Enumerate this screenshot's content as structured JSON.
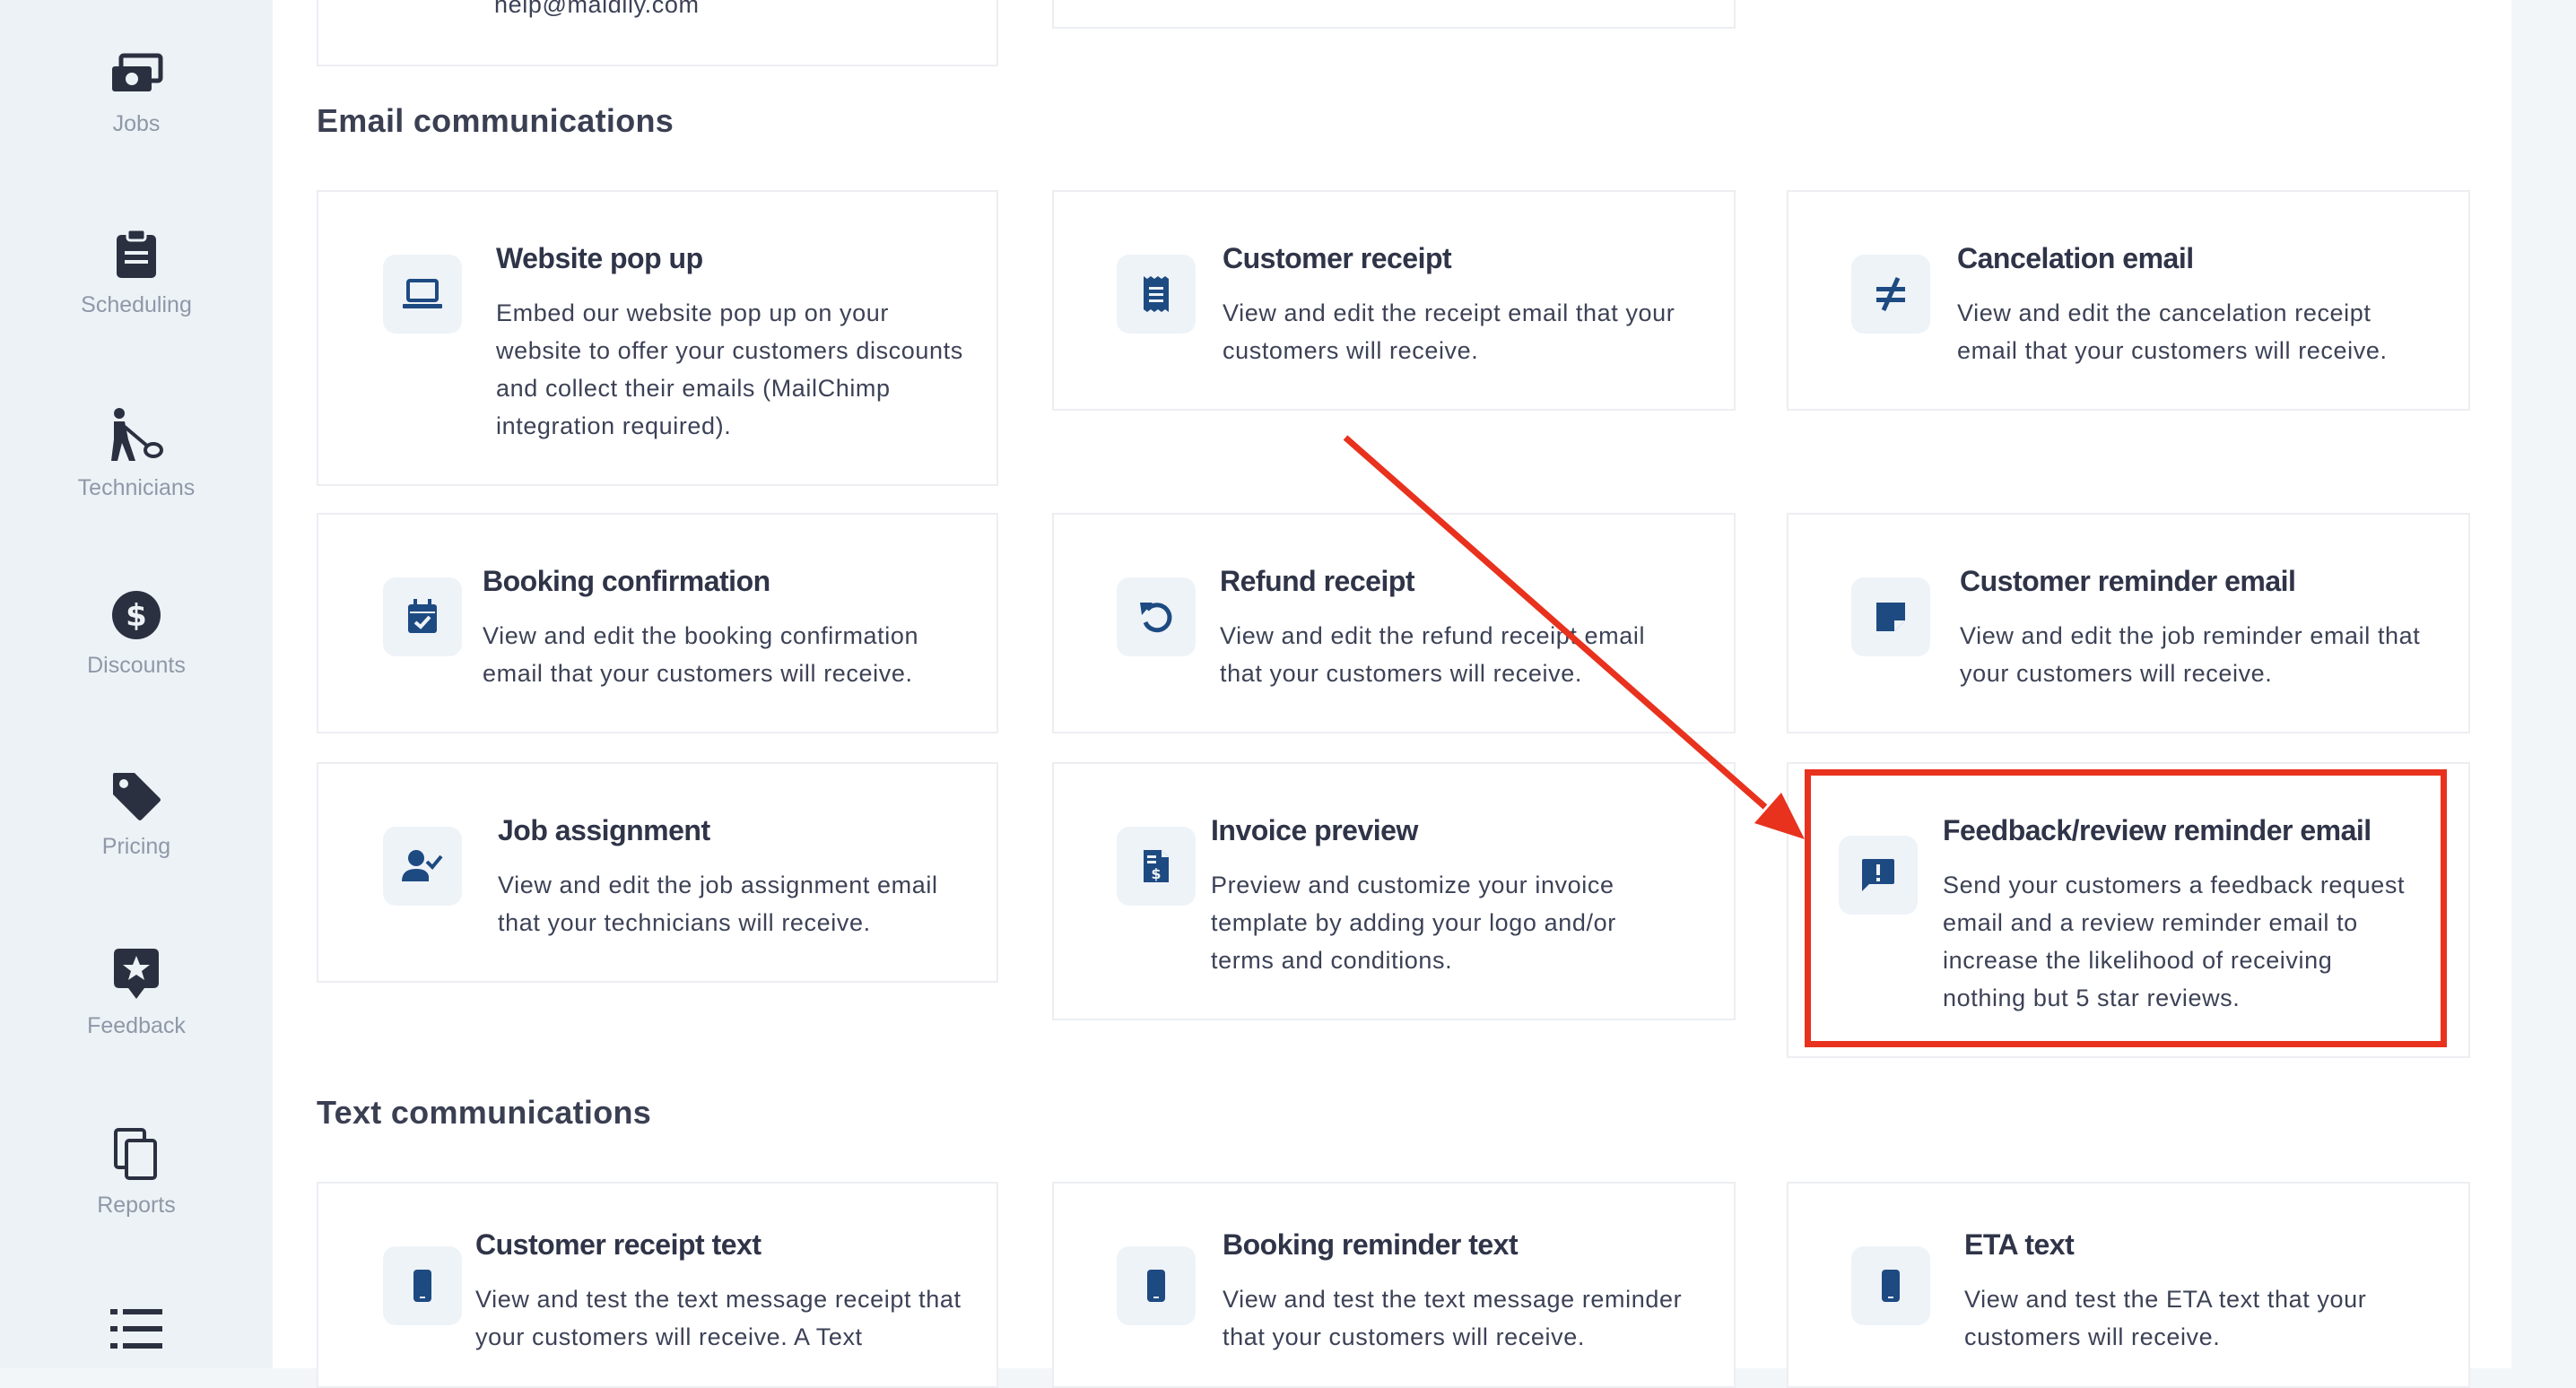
{
  "sidebar": {
    "items": [
      {
        "label": "Jobs",
        "icon": "jobs-icon"
      },
      {
        "label": "Scheduling",
        "icon": "clipboard-icon"
      },
      {
        "label": "Technicians",
        "icon": "technician-icon"
      },
      {
        "label": "Discounts",
        "icon": "dollar-icon"
      },
      {
        "label": "Pricing",
        "icon": "tag-icon"
      },
      {
        "label": "Feedback",
        "icon": "star-badge-icon"
      },
      {
        "label": "Reports",
        "icon": "copy-icon"
      },
      {
        "label": "",
        "icon": "list-icon"
      }
    ]
  },
  "top": {
    "email_snippet": "help@maidily.com"
  },
  "email_section": {
    "title": "Email communications",
    "cards": [
      {
        "title": "Website pop up",
        "icon": "laptop-icon",
        "desc": [
          "Embed our website pop up on your",
          "website to offer your customers discounts",
          "and collect their emails (MailChimp",
          "integration required)."
        ]
      },
      {
        "title": "Customer receipt",
        "icon": "receipt-icon",
        "desc": [
          "View and edit the receipt email that your",
          "customers will receive."
        ]
      },
      {
        "title": "Cancelation email",
        "icon": "not-equal-icon",
        "desc": [
          "View and edit the cancelation receipt",
          "email that your customers will receive."
        ]
      },
      {
        "title": "Booking confirmation",
        "icon": "calendar-check-icon",
        "desc": [
          "View and edit the booking confirmation",
          "email that your customers will receive."
        ]
      },
      {
        "title": "Refund receipt",
        "icon": "undo-icon",
        "desc": [
          "View and edit the refund receipt email",
          "that your customers will receive."
        ]
      },
      {
        "title": "Customer reminder email",
        "icon": "sticky-note-icon",
        "desc": [
          "View and edit the job reminder email that",
          "your customers will receive."
        ]
      },
      {
        "title": "Job assignment",
        "icon": "user-check-icon",
        "desc": [
          "View and edit the job assignment email",
          "that your technicians will receive."
        ]
      },
      {
        "title": "Invoice preview",
        "icon": "invoice-icon",
        "desc": [
          "Preview and customize your invoice",
          "template by adding your logo and/or",
          "terms and conditions."
        ]
      },
      {
        "title": "Feedback/review reminder email",
        "icon": "feedback-message-icon",
        "desc": [
          "Send your customers a feedback request",
          "email and a review reminder email to",
          "increase the likelihood of receiving",
          "nothing but 5 star reviews."
        ]
      }
    ]
  },
  "text_section": {
    "title": "Text communications",
    "cards": [
      {
        "title": "Customer receipt text",
        "icon": "phone-icon",
        "desc": [
          "View and test the text message receipt that",
          "your customers will receive. A Text"
        ]
      },
      {
        "title": "Booking reminder text",
        "icon": "phone-icon",
        "desc": [
          "View and test the text message reminder",
          "that your customers will receive."
        ]
      },
      {
        "title": "ETA text",
        "icon": "phone-icon",
        "desc": [
          "View and test the ETA text that your",
          "customers will receive."
        ]
      }
    ]
  },
  "colors": {
    "icon": "#1e4a82",
    "annotation": "#e8321e",
    "sidebar_bg": "#edf2f6"
  }
}
